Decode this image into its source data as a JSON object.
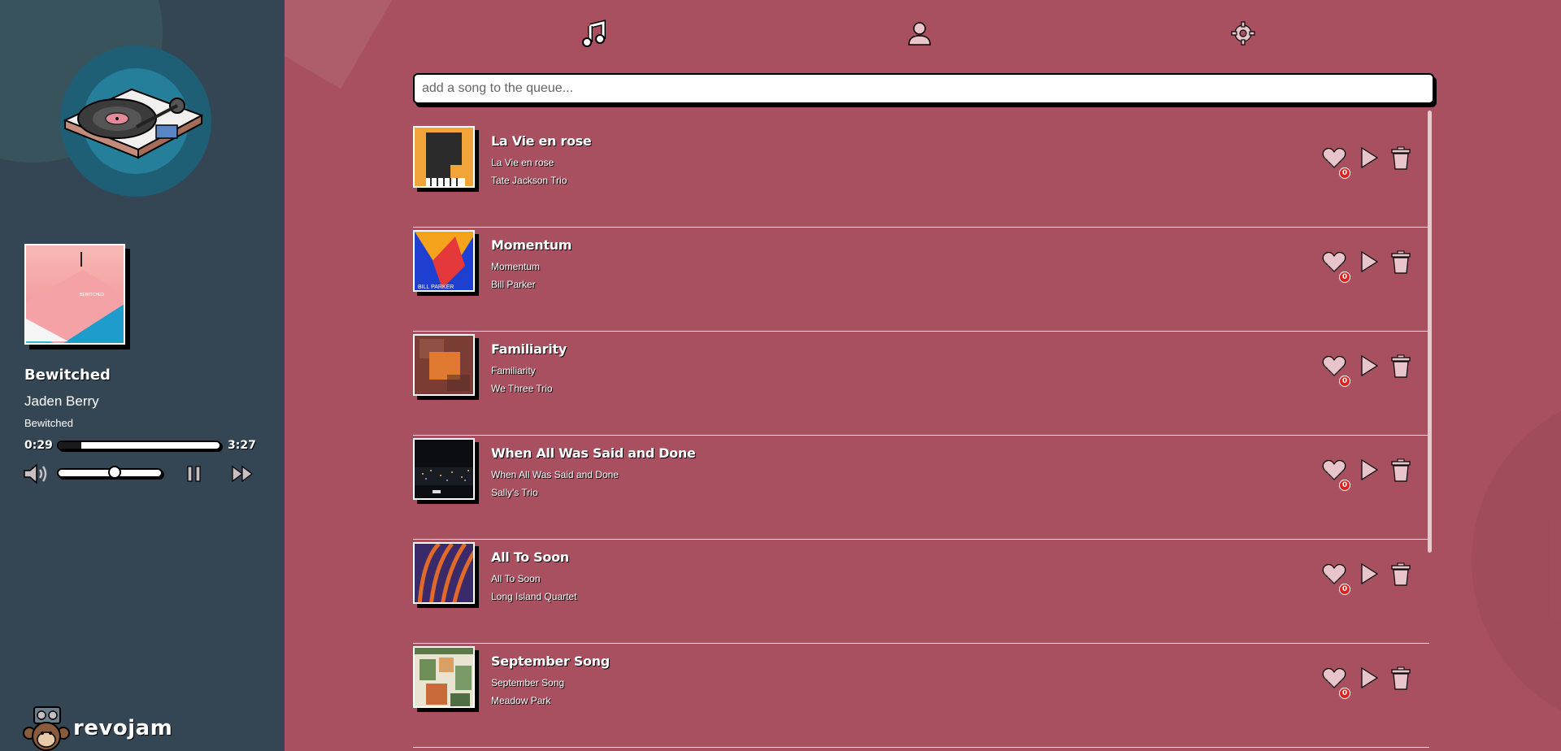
{
  "sidebar": {
    "now_playing": {
      "title": "Bewitched",
      "artist": "Jaden Berry",
      "album": "Bewitched",
      "current_time": "0:29",
      "total_time": "3:27",
      "progress": 0.14,
      "volume": 0.55
    },
    "brand": {
      "name": "revojam"
    }
  },
  "nav": {
    "icons": [
      "music-note-icon",
      "user-icon",
      "gear-icon"
    ]
  },
  "search": {
    "placeholder": "add a song to the queue..."
  },
  "queue": [
    {
      "title": "La Vie en rose",
      "album": "La Vie en rose",
      "artist": "Tate Jackson Trio",
      "likes": "0",
      "art": "piano-orange"
    },
    {
      "title": "Momentum",
      "album": "Momentum",
      "artist": "Bill Parker",
      "likes": "0",
      "art": "blue-red-triangles"
    },
    {
      "title": "Familiarity",
      "album": "Familiarity",
      "artist": "We Three Trio",
      "likes": "0",
      "art": "orange-texture"
    },
    {
      "title": "When All Was Said and Done",
      "album": "When All Was Said and Done",
      "artist": "Sally's Trio",
      "likes": "0",
      "art": "night-city"
    },
    {
      "title": "All To Soon",
      "album": "All To Soon",
      "artist": "Long Island Quartet",
      "likes": "0",
      "art": "orange-blue-arches"
    },
    {
      "title": "September Song",
      "album": "September Song",
      "artist": "Meadow Park",
      "likes": "0",
      "art": "green-collage"
    }
  ],
  "colors": {
    "sidebar": "#344654",
    "main": "#a8505f",
    "badge": "#e02020",
    "icon": "#e8c5cb"
  }
}
